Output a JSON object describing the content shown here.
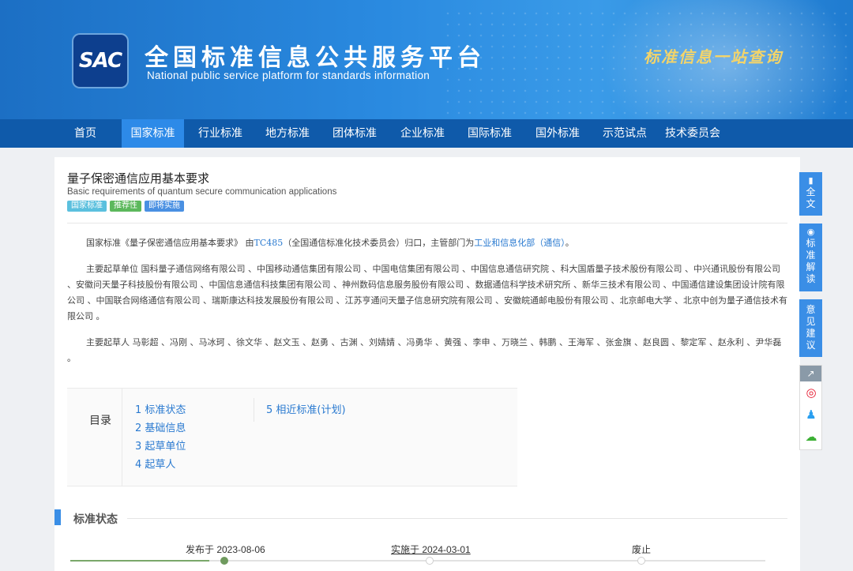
{
  "header": {
    "logo_text": "SAC",
    "title_cn": "全国标准信息公共服务平台",
    "title_en": "National public service platform  for standards information",
    "slogan": "标准信息一站查询"
  },
  "nav": {
    "items": [
      "首页",
      "国家标准",
      "行业标准",
      "地方标准",
      "团体标准",
      "企业标准",
      "国际标准",
      "国外标准",
      "示范试点",
      "技术委员会"
    ],
    "active_index": 1
  },
  "standard": {
    "title": "量子保密通信应用基本要求",
    "subtitle": "Basic requirements of quantum secure communication applications",
    "tags": [
      {
        "label": "国家标准",
        "color": "#5bc0de"
      },
      {
        "label": "推荐性",
        "color": "#5cb85c"
      },
      {
        "label": "即将实施",
        "color": "#4a90e2"
      }
    ],
    "intro": {
      "prefix": "国家标准《量子保密通信应用基本要求》 由",
      "tc_link": "TC485",
      "middle": "（全国通信标准化技术委员会）归口，主管部门为",
      "dept_link": "工业和信息化部（通信）",
      "suffix": "。"
    },
    "drafting_units": "主要起草单位 国科量子通信网络有限公司 、中国移动通信集团有限公司 、中国电信集团有限公司 、中国信息通信研究院 、科大国盾量子技术股份有限公司 、中兴通讯股份有限公司 、安徽问天量子科技股份有限公司 、中国信息通信科技集团有限公司 、神州数码信息服务股份有限公司 、数据通信科学技术研究所 、新华三技术有限公司 、中国通信建设集团设计院有限公司 、中国联合网络通信有限公司 、瑞斯康达科技发展股份有限公司 、江苏亨通问天量子信息研究院有限公司 、安徽皖通邮电股份有限公司 、北京邮电大学 、北京中创为量子通信技术有限公司 。",
    "drafters": "主要起草人 马彰超 、冯刚 、马冰珂 、徐文华 、赵文玉 、赵勇 、古渊 、刘婧婧 、冯勇华 、黄强 、李申 、万晓兰 、韩鹏 、王海军 、张金旗 、赵良圆 、黎定军 、赵永利 、尹华磊 。"
  },
  "toc": {
    "heading": "目录",
    "items": [
      "1 标准状态",
      "2 基础信息",
      "3 起草单位",
      "4 起草人",
      "5 相近标准(计划)"
    ]
  },
  "status_section": {
    "title": "标准状态",
    "timeline": {
      "published": "发布于 2023-08-06",
      "implemented": "实施于 2024-03-01",
      "abolished": "废止",
      "progress": 0.2
    }
  },
  "sidebar": {
    "fulltext": "全文",
    "interpretation": "标准解读",
    "feedback": "意见建议"
  },
  "colors": {
    "nav_bg": "#0f5aaa",
    "nav_active": "#2d8ae8",
    "accent": "#3a8ee6",
    "link": "#2a7ad0"
  }
}
